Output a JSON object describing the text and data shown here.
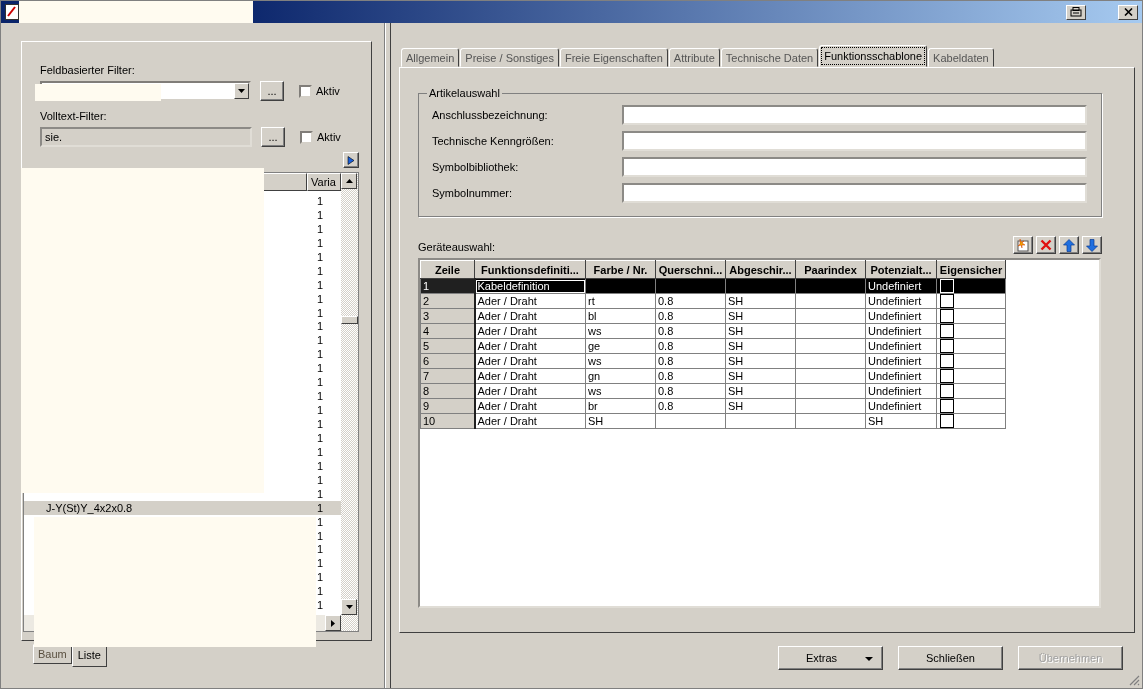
{
  "left_panel": {
    "field_filter": {
      "label": "Feldbasierter Filter:",
      "browse_button": "...",
      "active_label": "Aktiv",
      "active": false
    },
    "fulltext_filter": {
      "label": "Volltext-Filter:",
      "value": "sie.",
      "browse_button": "...",
      "active_label": "Aktiv",
      "active": false
    },
    "list": {
      "columns": [
        "Varia"
      ],
      "rows": [
        {
          "variant": "1",
          "selected": false
        },
        {
          "variant": "1",
          "selected": false
        },
        {
          "variant": "1",
          "selected": false
        },
        {
          "variant": "1",
          "selected": false
        },
        {
          "variant": "1",
          "selected": false
        },
        {
          "variant": "1",
          "selected": false
        },
        {
          "variant": "1",
          "selected": false
        },
        {
          "variant": "1",
          "selected": false
        },
        {
          "variant": "1",
          "selected": false
        },
        {
          "variant": "1",
          "selected": false
        },
        {
          "variant": "1",
          "selected": false
        },
        {
          "variant": "1",
          "selected": false
        },
        {
          "variant": "1",
          "selected": false
        },
        {
          "variant": "1",
          "selected": false
        },
        {
          "variant": "1",
          "selected": false
        },
        {
          "variant": "1",
          "selected": false
        },
        {
          "variant": "1",
          "selected": false
        },
        {
          "variant": "1",
          "selected": false
        },
        {
          "variant": "1",
          "selected": false
        },
        {
          "variant": "1",
          "selected": false
        },
        {
          "variant": "1",
          "selected": false
        },
        {
          "variant": "1",
          "selected": false
        },
        {
          "name": "J-Y(St)Y_4x2x0.8",
          "variant": "1",
          "selected": true
        },
        {
          "variant": "1",
          "selected": false
        },
        {
          "variant": "1",
          "selected": false
        },
        {
          "variant": "1",
          "selected": false
        },
        {
          "variant": "1",
          "selected": false
        },
        {
          "variant": "1",
          "selected": false
        },
        {
          "variant": "1",
          "selected": false
        },
        {
          "variant": "1",
          "selected": false
        }
      ]
    },
    "tabs": [
      {
        "label": "Baum",
        "selected": false
      },
      {
        "label": "Liste",
        "selected": true
      }
    ]
  },
  "tabs": [
    {
      "label": "Allgemein",
      "selected": false
    },
    {
      "label": "Preise / Sonstiges",
      "selected": false
    },
    {
      "label": "Freie Eigenschaften",
      "selected": false
    },
    {
      "label": "Attribute",
      "selected": false
    },
    {
      "label": "Technische Daten",
      "selected": false
    },
    {
      "label": "Funktionsschablone",
      "selected": true
    },
    {
      "label": "Kabeldaten",
      "selected": false
    }
  ],
  "article_selection": {
    "title": "Artikelauswahl",
    "fields": [
      {
        "label": "Anschlussbezeichnung:"
      },
      {
        "label": "Technische Kenngrößen:"
      },
      {
        "label": "Symbolbibliothek:"
      },
      {
        "label": "Symbolnummer:"
      }
    ]
  },
  "device_selection": {
    "label": "Geräteauswahl:",
    "columns": [
      "Zeile",
      "Funktionsdefiniti...",
      "Farbe / Nr.",
      "Querschni...",
      "Abgeschir...",
      "Paarindex",
      "Potenzialt...",
      "Eigensicher"
    ],
    "rows": [
      {
        "cells": [
          "1",
          "Kabeldefinition",
          "",
          "",
          "",
          "",
          "Undefiniert"
        ],
        "intrinsically_safe": false,
        "selected": true
      },
      {
        "cells": [
          "2",
          "Ader / Draht",
          "rt",
          "0.8",
          "SH",
          "",
          "Undefiniert"
        ],
        "intrinsically_safe": false,
        "selected": false
      },
      {
        "cells": [
          "3",
          "Ader / Draht",
          "bl",
          "0.8",
          "SH",
          "",
          "Undefiniert"
        ],
        "intrinsically_safe": false,
        "selected": false
      },
      {
        "cells": [
          "4",
          "Ader / Draht",
          "ws",
          "0.8",
          "SH",
          "",
          "Undefiniert"
        ],
        "intrinsically_safe": false,
        "selected": false
      },
      {
        "cells": [
          "5",
          "Ader / Draht",
          "ge",
          "0.8",
          "SH",
          "",
          "Undefiniert"
        ],
        "intrinsically_safe": false,
        "selected": false
      },
      {
        "cells": [
          "6",
          "Ader / Draht",
          "ws",
          "0.8",
          "SH",
          "",
          "Undefiniert"
        ],
        "intrinsically_safe": false,
        "selected": false
      },
      {
        "cells": [
          "7",
          "Ader / Draht",
          "gn",
          "0.8",
          "SH",
          "",
          "Undefiniert"
        ],
        "intrinsically_safe": false,
        "selected": false
      },
      {
        "cells": [
          "8",
          "Ader / Draht",
          "ws",
          "0.8",
          "SH",
          "",
          "Undefiniert"
        ],
        "intrinsically_safe": false,
        "selected": false
      },
      {
        "cells": [
          "9",
          "Ader / Draht",
          "br",
          "0.8",
          "SH",
          "",
          "Undefiniert"
        ],
        "intrinsically_safe": false,
        "selected": false
      },
      {
        "cells": [
          "10",
          "Ader / Draht",
          "SH",
          "",
          "",
          "",
          "SH"
        ],
        "intrinsically_safe": false,
        "selected": false
      }
    ]
  },
  "buttons": [
    {
      "label": "Extras",
      "kind": "menu",
      "disabled": false
    },
    {
      "label": "Schließen",
      "kind": "plain",
      "disabled": false
    },
    {
      "label": "Übernehmen",
      "kind": "plain",
      "disabled": true
    }
  ]
}
